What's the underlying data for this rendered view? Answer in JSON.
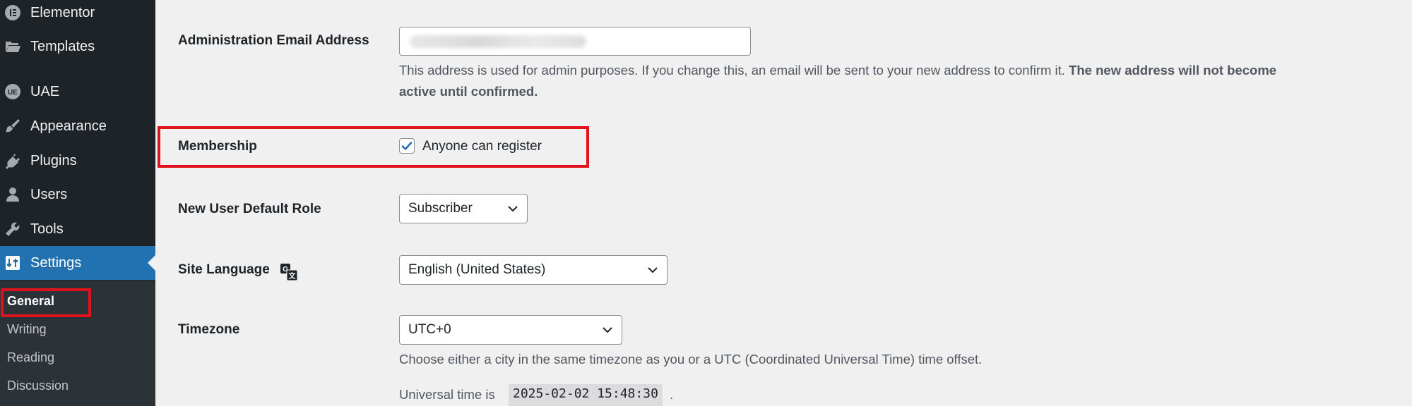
{
  "sidebar": {
    "items": [
      {
        "label": "Elementor",
        "icon": "elementor-icon"
      },
      {
        "label": "Templates",
        "icon": "folder-icon"
      },
      {
        "label": "UAE",
        "icon": "uae-icon"
      },
      {
        "label": "Appearance",
        "icon": "paintbrush-icon"
      },
      {
        "label": "Plugins",
        "icon": "plugin-icon"
      },
      {
        "label": "Users",
        "icon": "user-icon"
      },
      {
        "label": "Tools",
        "icon": "wrench-icon"
      },
      {
        "label": "Settings",
        "icon": "settings-icon",
        "active": true
      }
    ],
    "submenu": [
      "General",
      "Writing",
      "Reading",
      "Discussion"
    ],
    "current_submenu": "General"
  },
  "form": {
    "admin_email": {
      "label": "Administration Email Address",
      "desc_plain": "This address is used for admin purposes. If you change this, an email will be sent to your new address to confirm it.",
      "desc_bold_1": "The new address will not become",
      "desc_bold_2": "active until confirmed."
    },
    "membership": {
      "label": "Membership",
      "checkbox_label": "Anyone can register",
      "checked": true
    },
    "default_role": {
      "label": "New User Default Role",
      "value": "Subscriber"
    },
    "site_language": {
      "label": "Site Language",
      "value": "English (United States)"
    },
    "timezone": {
      "label": "Timezone",
      "value": "UTC+0",
      "desc": "Choose either a city in the same timezone as you or a UTC (Coordinated Universal Time) time offset.",
      "universal_prefix": "Universal time is",
      "universal_value": "2025-02-02 15:48:30",
      "universal_suffix": "."
    }
  },
  "colors": {
    "sidebar_bg": "#1d2327",
    "active_bg": "#2271b1",
    "highlight": "#e0121b",
    "page_bg": "#f0f0f1"
  }
}
